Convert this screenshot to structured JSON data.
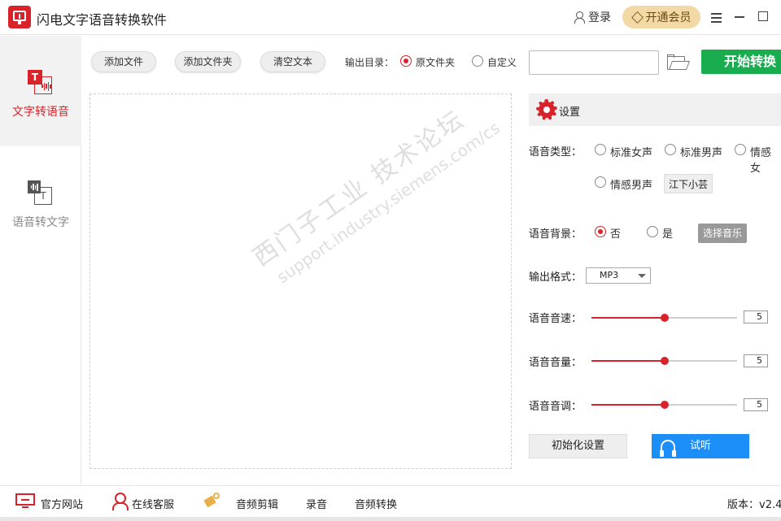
{
  "window": {
    "title": "闪电文字语音转换软件",
    "login": "登录",
    "vip": "开通会员"
  },
  "sidebar": {
    "items": [
      {
        "label": "文字转语音",
        "active": true,
        "icon": "text-to-speech-icon"
      },
      {
        "label": "语音转文字",
        "active": false,
        "icon": "speech-to-text-icon"
      }
    ]
  },
  "toolbar": {
    "add_file": "添加文件",
    "add_folder": "添加文件夹",
    "clear_text": "清空文本",
    "output_label": "输出目录：",
    "output_options": [
      "原文件夹",
      "自定义"
    ],
    "output_selected": "原文件夹",
    "path_value": "",
    "start": "开始转换"
  },
  "watermark": {
    "line1": "西门子工业 技术论坛",
    "line2": "support.industry.siemens.com/cs"
  },
  "settings": {
    "title": "设置",
    "voice_type_label": "语音类型：",
    "voice_options": [
      "标准女声",
      "标准男声",
      "情感女",
      "情感男声"
    ],
    "voice_selected": "",
    "voice_button": "江下小芸",
    "background_label": "语音背景：",
    "background_options": [
      "否",
      "是"
    ],
    "background_selected": "否",
    "music_button": "选择音乐",
    "format_label": "输出格式：",
    "format_value": "MP3",
    "speed_label": "语音音速：",
    "speed_value": "5",
    "volume_label": "语音音量：",
    "volume_value": "5",
    "pitch_label": "语音音调：",
    "pitch_value": "5",
    "slider_max": 10,
    "reset_button": "初始化设置",
    "listen_button": "试听"
  },
  "bottom": {
    "website": "官方网站",
    "support": "在线客服",
    "audio_edit": "音频剪辑",
    "record": "录音",
    "audio_convert": "音频转换",
    "version": "版本：v2.4"
  },
  "colors": {
    "accent": "#d9232a",
    "start_green": "#1aad50",
    "listen_blue": "#1b8ef7",
    "vip_gold": "#f2d9a6"
  }
}
